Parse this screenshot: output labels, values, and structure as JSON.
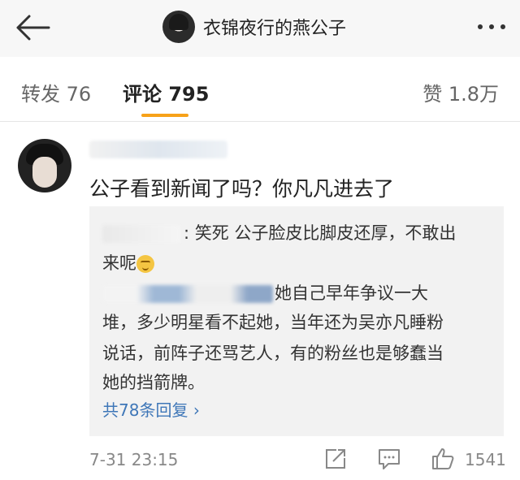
{
  "header": {
    "title": "衣锦夜行的燕公子"
  },
  "tabs": {
    "repost_label": "转发",
    "repost_count": "76",
    "comment_label": "评论",
    "comment_count": "795",
    "like_label": "赞",
    "like_count": "1.8万"
  },
  "comment": {
    "text": "公子看到新闻了吗？你凡凡进去了",
    "reply_1": ": 笑死 公子脸皮比脚皮还厚，不敢出",
    "reply_1b": "来呢",
    "reply_2a": "她自己早年争议一大",
    "reply_2b": "堆，多少明星看不起她，当年还为吴亦凡睡粉",
    "reply_2c": "说话，前阵子还骂艺人，有的粉丝也是够蠢当",
    "reply_2d": "她的挡箭牌。",
    "more_replies": "共78条回复 ",
    "time": "7-31 23:15",
    "likes": "1541"
  },
  "icons": {
    "back": "back-arrow-icon",
    "more": "more-dots-icon",
    "share": "share-icon",
    "reply": "reply-icon",
    "like": "thumbs-up-icon"
  },
  "colors": {
    "accent": "#f7a219",
    "link": "#3f77b8"
  }
}
